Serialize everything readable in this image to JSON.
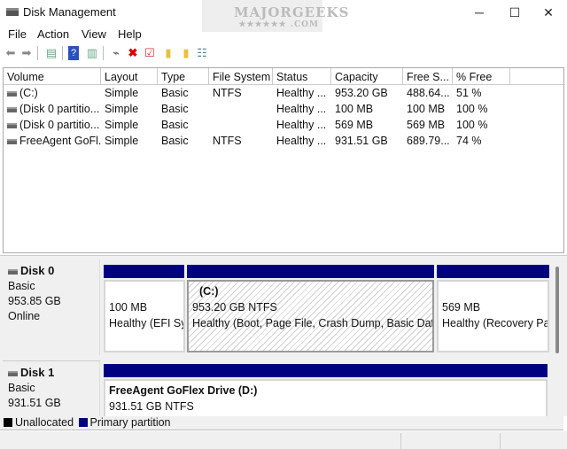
{
  "window": {
    "title": "Disk Management",
    "minimize": "─",
    "maximize": "☐",
    "close": "✕"
  },
  "watermark": {
    "text": "MAJORGEEKS",
    ".com": ".COM"
  },
  "menu": [
    "File",
    "Action",
    "View",
    "Help"
  ],
  "toolbar": [
    "back-icon",
    "forward-icon",
    "console-tree-icon",
    "help-icon",
    "show-pane-icon",
    "connect-icon",
    "delete-icon",
    "properties-icon",
    "up-folder-icon",
    "search-folder-icon",
    "list-icon"
  ],
  "columns": [
    "Volume",
    "Layout",
    "Type",
    "File System",
    "Status",
    "Capacity",
    "Free S...",
    "% Free"
  ],
  "rows": [
    [
      "(C:)",
      "Simple",
      "Basic",
      "NTFS",
      "Healthy ...",
      "953.20 GB",
      "488.64...",
      "51 %"
    ],
    [
      "(Disk 0 partitio...",
      "Simple",
      "Basic",
      "",
      "Healthy ...",
      "100 MB",
      "100 MB",
      "100 %"
    ],
    [
      "(Disk 0 partitio...",
      "Simple",
      "Basic",
      "",
      "Healthy ...",
      "569 MB",
      "569 MB",
      "100 %"
    ],
    [
      "FreeAgent GoFl...",
      "Simple",
      "Basic",
      "NTFS",
      "Healthy ...",
      "931.51 GB",
      "689.79...",
      "74 %"
    ]
  ],
  "disks": [
    {
      "name": "Disk 0",
      "type": "Basic",
      "size": "953.85 GB",
      "state": "Online",
      "partitions": [
        {
          "title": "",
          "size": "100 MB",
          "status": "Healthy (EFI System Partition)"
        },
        {
          "title": "(C:)",
          "size": "953.20 GB NTFS",
          "status": "Healthy (Boot, Page File, Crash Dump, Basic Data Partition)"
        },
        {
          "title": "",
          "size": "569 MB",
          "status": "Healthy (Recovery Partition)"
        }
      ]
    },
    {
      "name": "Disk 1",
      "type": "Basic",
      "size": "931.51 GB",
      "partitions": [
        {
          "title": "FreeAgent GoFlex Drive  (D:)",
          "size": "931.51 GB NTFS"
        }
      ]
    }
  ],
  "legend": {
    "unallocated": "Unallocated",
    "primary": "Primary partition",
    "unallocated_color": "#000000",
    "primary_color": "#000080"
  }
}
